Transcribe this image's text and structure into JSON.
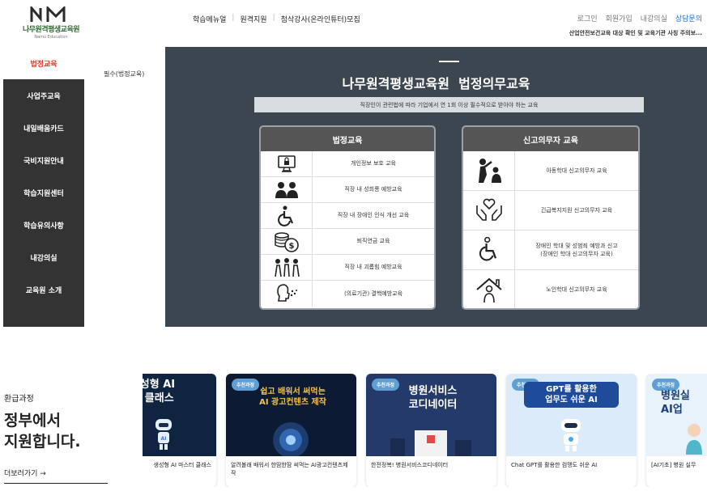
{
  "header": {
    "logo_text": "나무원격평생교육원",
    "logo_sub": "Namu Education",
    "nav": [
      "학습메뉴얼",
      "원격지원",
      "첨삭강사(온라인튜터)모집"
    ],
    "util": [
      "로그인",
      "회원가입",
      "내강의실",
      "상담문의"
    ],
    "ticker": "산업안전보건교육 대상 확인 및 교육기관 사칭 주의보..."
  },
  "sidebar": {
    "items": [
      "법정교육",
      "사업주교육",
      "내일배움카드",
      "국비지원안내",
      "학습지원센터",
      "학습유의사항",
      "내강의실",
      "교육원 소개"
    ],
    "sub_item": "필수(법정교육)"
  },
  "main": {
    "title": "나무원격평생교육원  법정의무교육",
    "subtitle": "직장인이 관련법에 따라 기업에서 연 1회 이상 필수적으로 받아야 하는 교육",
    "legal": {
      "heading": "법정교육",
      "rows": [
        {
          "label": "개인정보 보호 교육",
          "icon": "monitor-lock-icon"
        },
        {
          "label": "직장 내 성희롱 예방교육",
          "icon": "people-talking-icon"
        },
        {
          "label": "직장 내 장애인 인식 개선 교육",
          "icon": "wheelchair-icon"
        },
        {
          "label": "퇴직연금 교육",
          "icon": "coins-icon"
        },
        {
          "label": "직장 내 괴롭힘 예방교육",
          "icon": "group-people-icon"
        },
        {
          "label": "(의료기관) 결핵예방교육",
          "icon": "cough-icon"
        }
      ]
    },
    "report": {
      "heading": "신고의무자 교육",
      "rows": [
        {
          "label": "아동학대 신고의무자 교육",
          "icon": "child-abuse-icon"
        },
        {
          "label": "긴급복지지원 신고의무자 교육",
          "icon": "heart-hands-icon"
        },
        {
          "label": "장애인 학대 및 성범죄 예방과 신고\n(장애인 학대 신고의무자 교육)",
          "icon": "wheelchair-icon"
        },
        {
          "label": "노인학대 신고의무자 교육",
          "icon": "elder-house-icon"
        }
      ]
    }
  },
  "promo": {
    "kicker": "환급과정",
    "headline_1": "정부에서",
    "headline_2": "지원합니다.",
    "more": "더보러가기 →"
  },
  "cards": [
    {
      "badge": "",
      "headline": "생성형 AI\n터 클래스",
      "title": "생성형 AI 마스터 클래스",
      "bg": "#0f2440",
      "fg": "#ffffff"
    },
    {
      "badge": "추천과정",
      "headline": "쉽고 배워서 써먹는\nAI 광고컨텐츠 제작",
      "title": "알려볼래 배워서 한땀한땀 써먹는 AI광고컨텐츠제작",
      "bg": "#0c1b33",
      "fg": "#f2c14e"
    },
    {
      "badge": "추천과정",
      "headline": "병원서비스\n코디네이터",
      "title": "한전정복! 병원서비스코디네이터",
      "bg": "#243a6b",
      "fg": "#ffffff"
    },
    {
      "badge": "추천과정",
      "headline": "GPT를 활용한\n업무도 쉬운 AI",
      "title": "Chat GPT를 활용한 컴맹도 쉬운 AI",
      "bg": "#dcebfa",
      "fg": "#1b3f7a"
    },
    {
      "badge": "추천과정",
      "headline": "병원실\nAI업",
      "title": "[AI기초] 병원 실무",
      "bg": "#e8f2fb",
      "fg": "#1b3f7a"
    }
  ]
}
